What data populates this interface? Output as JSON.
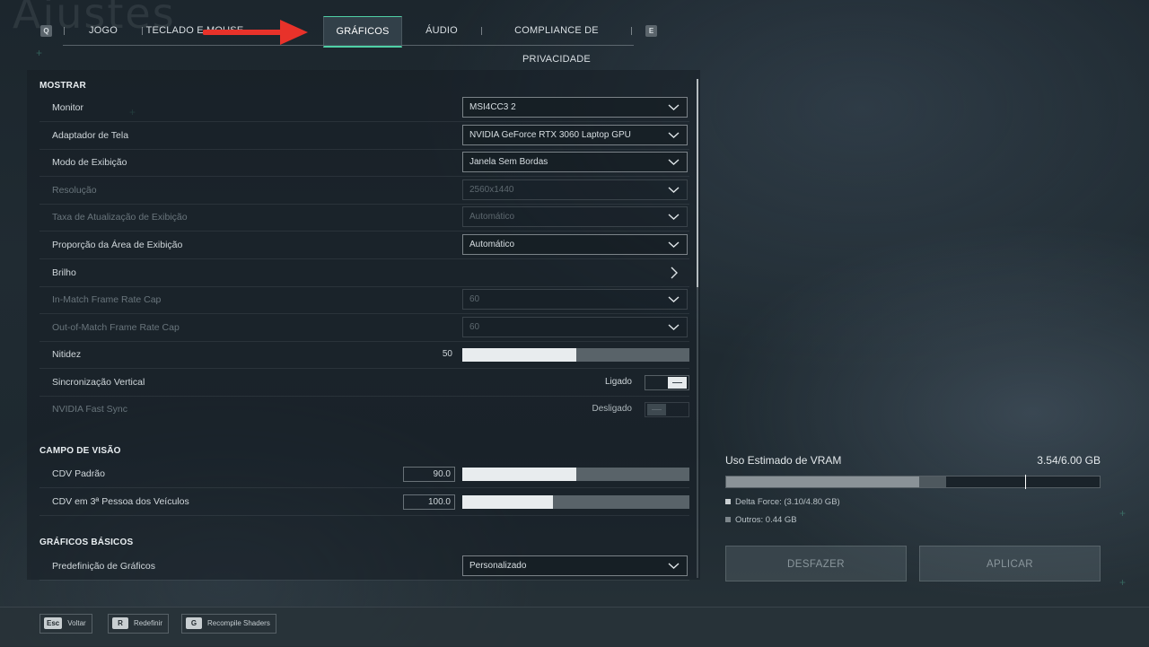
{
  "page_title_bg": "Ajustes",
  "tabs": {
    "left_key": "Q",
    "right_key": "E",
    "items": [
      {
        "label": "JOGO"
      },
      {
        "label": "TECLADO E MOUSE"
      },
      {
        "label": "GRÁFICOS"
      },
      {
        "label": "ÁUDIO"
      },
      {
        "label": "COMPLIANCE DE PRIVACIDADE"
      }
    ],
    "active": "GRÁFICOS"
  },
  "annotation": {
    "type": "arrow",
    "color": "#e8322a",
    "points_to": "GRÁFICOS"
  },
  "sections": {
    "mostrar": "MOSTRAR",
    "campo": "CAMPO DE VISÃO",
    "basicos": "GRÁFICOS BÁSICOS"
  },
  "settings": {
    "monitor": {
      "label": "Monitor",
      "value": "MSI4CC3 2"
    },
    "adaptador": {
      "label": "Adaptador de Tela",
      "value": "NVIDIA GeForce RTX 3060 Laptop GPU"
    },
    "modo": {
      "label": "Modo de Exibição",
      "value": "Janela Sem Bordas"
    },
    "resolucao": {
      "label": "Resolução",
      "value": "2560x1440",
      "disabled": true
    },
    "taxa": {
      "label": "Taxa de Atualização de Exibição",
      "value": "Automático",
      "disabled": true
    },
    "proporcao": {
      "label": "Proporção da Área de Exibição",
      "value": "Automático"
    },
    "brilho": {
      "label": "Brilho"
    },
    "inmatch": {
      "label": "In-Match Frame Rate Cap",
      "value": "60",
      "disabled": true
    },
    "outmatch": {
      "label": "Out-of-Match Frame Rate Cap",
      "value": "60",
      "disabled": true
    },
    "nitidez": {
      "label": "Nitidez",
      "value": "50",
      "fraction": 0.5
    },
    "vsync": {
      "label": "Sincronização Vertical",
      "value": "Ligado",
      "on": true
    },
    "fastsync": {
      "label": "NVIDIA Fast Sync",
      "value": "Desligado",
      "disabled": true
    },
    "cdv_padrao": {
      "label": "CDV Padrão",
      "value": "90.0",
      "fraction": 0.5
    },
    "cdv_veiculos": {
      "label": "CDV em 3ª Pessoa dos Veículos",
      "value": "100.0",
      "fraction": 0.4
    },
    "predefinicao": {
      "label": "Predefinição de Gráficos",
      "value": "Personalizado"
    }
  },
  "vram": {
    "title": "Uso Estimado de VRAM",
    "value": "3.54/6.00 GB",
    "delta_fraction": 0.517,
    "others_fraction": 0.073,
    "marker_fraction": 0.8,
    "legend_delta": "Delta Force: (3.10/4.80 GB)",
    "legend_others": "Outros: 0.44 GB",
    "colors": {
      "delta": "#8a9297",
      "others": "#4e585e"
    }
  },
  "buttons": {
    "undo": "DESFAZER",
    "apply": "APLICAR"
  },
  "hints": [
    {
      "key": "Esc",
      "label": "Voltar"
    },
    {
      "key": "R",
      "label": "Redefinir"
    },
    {
      "key": "G",
      "label": "Recompile Shaders"
    }
  ],
  "accent_color": "#4fd1a6"
}
